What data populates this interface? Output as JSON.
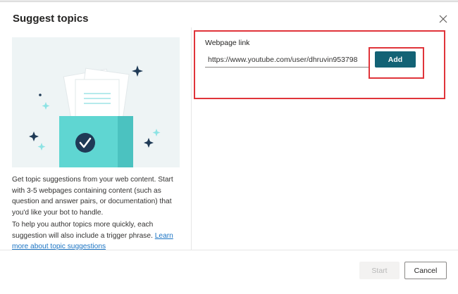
{
  "dialog": {
    "title": "Suggest topics",
    "close_icon": "close-icon"
  },
  "left_panel": {
    "illustration": "documents-folder-checkmark-illustration",
    "description": "Get topic suggestions from your web content. Start with 3-5 webpages containing content (such as question and answer pairs, or documentation) that you'd like your bot to handle.",
    "help_text": "To help you author topics more quickly, each suggestion will also include a trigger phrase. ",
    "help_link": "Learn more about topic suggestions"
  },
  "right_panel": {
    "webpage_label": "Webpage link",
    "webpage_value": "https://www.youtube.com/user/dhruvin953798",
    "add_label": "Add"
  },
  "footer": {
    "start_label": "Start",
    "cancel_label": "Cancel"
  },
  "colors": {
    "accent": "#136275",
    "highlight": "#e0343a",
    "illustration_bg": "#eef4f5",
    "folder": "#5fd6d2",
    "sparkle_dark": "#1f3a56",
    "sparkle_light": "#8de3e4"
  }
}
